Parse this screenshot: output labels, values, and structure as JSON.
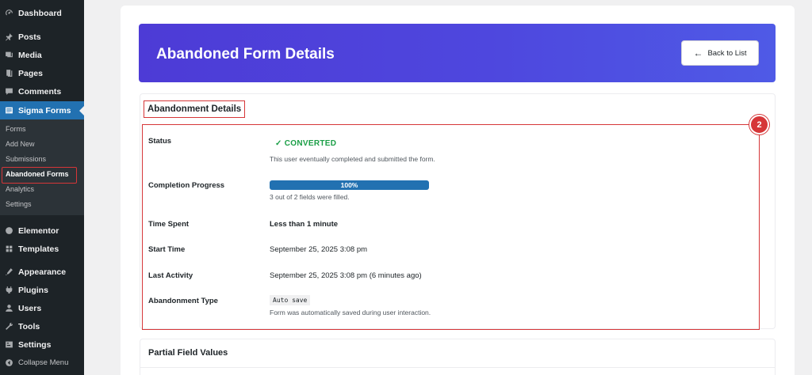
{
  "sidebar": {
    "top_items": [
      {
        "label": "Dashboard",
        "icon": "dashboard-icon"
      },
      {
        "label": "Posts",
        "icon": "pin-icon"
      },
      {
        "label": "Media",
        "icon": "media-icon"
      },
      {
        "label": "Pages",
        "icon": "pages-icon"
      },
      {
        "label": "Comments",
        "icon": "comments-icon"
      },
      {
        "label": "Sigma Forms",
        "icon": "forms-icon"
      }
    ],
    "submenu": [
      "Forms",
      "Add New",
      "Submissions",
      "Abandoned Forms",
      "Analytics",
      "Settings"
    ],
    "bottom_items": [
      {
        "label": "Elementor",
        "icon": "elementor-icon"
      },
      {
        "label": "Templates",
        "icon": "templates-icon"
      },
      {
        "label": "Appearance",
        "icon": "appearance-icon"
      },
      {
        "label": "Plugins",
        "icon": "plugins-icon"
      },
      {
        "label": "Users",
        "icon": "users-icon"
      },
      {
        "label": "Tools",
        "icon": "tools-icon"
      },
      {
        "label": "Settings",
        "icon": "settings-icon"
      },
      {
        "label": "Collapse Menu",
        "icon": "collapse-icon"
      }
    ]
  },
  "header": {
    "title": "Abandoned Form Details",
    "back_label": "Back to List"
  },
  "details": {
    "section_title": "Abandonment Details",
    "badge": "2",
    "status_label": "Status",
    "status_value": "✓ CONVERTED",
    "status_note": "This user eventually completed and submitted the form.",
    "progress_label": "Completion Progress",
    "progress_value": "100%",
    "progress_fraction": 1.0,
    "progress_note": "3 out of 2 fields were filled.",
    "time_spent_label": "Time Spent",
    "time_spent_value": "Less than 1 minute",
    "start_time_label": "Start Time",
    "start_time_value": "September 25, 2025 3:08 pm",
    "last_activity_label": "Last Activity",
    "last_activity_value": "September 25, 2025 3:08 pm (6 minutes ago)",
    "type_label": "Abandonment Type",
    "type_value": "Auto save",
    "type_note": "Form was automatically saved during user interaction."
  },
  "partial": {
    "title": "Partial Field Values"
  },
  "colors": {
    "accent": "#2271b1",
    "highlight": "#d63638",
    "success": "#1a9e46",
    "hero": "#4d3bd6"
  }
}
